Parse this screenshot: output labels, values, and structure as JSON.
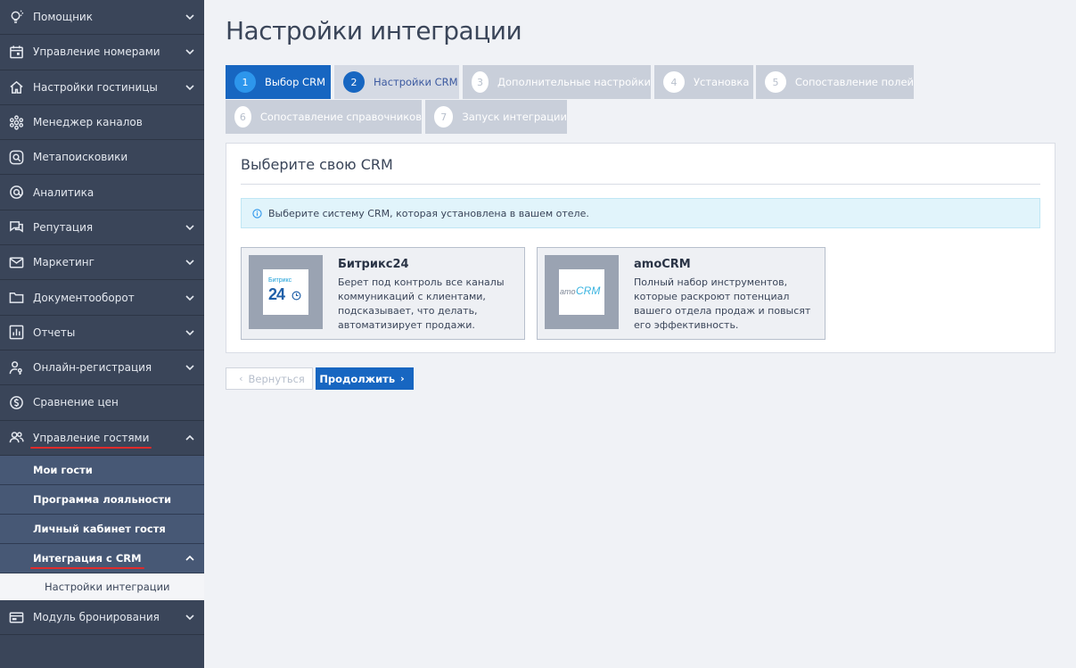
{
  "sidebar": {
    "items": [
      {
        "label": "Помощник",
        "icon": "lightbulb-icon",
        "chevron": "down"
      },
      {
        "label": "Управление номерами",
        "icon": "calendar-icon",
        "chevron": "down"
      },
      {
        "label": "Настройки гостиницы",
        "icon": "home-icon",
        "chevron": "down"
      },
      {
        "label": "Менеджер каналов",
        "icon": "network-icon",
        "chevron": "none"
      },
      {
        "label": "Метапоисковики",
        "icon": "search-icon",
        "chevron": "none"
      },
      {
        "label": "Аналитика",
        "icon": "at-icon",
        "chevron": "none"
      },
      {
        "label": "Репутация",
        "icon": "chat-icon",
        "chevron": "down"
      },
      {
        "label": "Маркетинг",
        "icon": "mail-icon",
        "chevron": "down"
      },
      {
        "label": "Документооборот",
        "icon": "folder-icon",
        "chevron": "down"
      },
      {
        "label": "Отчеты",
        "icon": "chart-icon",
        "chevron": "down"
      },
      {
        "label": "Онлайн-регистрация",
        "icon": "user-key-icon",
        "chevron": "down"
      },
      {
        "label": "Сравнение цен",
        "icon": "dollar-icon",
        "chevron": "none"
      },
      {
        "label": "Управление гостями",
        "icon": "users-icon",
        "chevron": "up"
      }
    ],
    "guests_sub": [
      {
        "label": "Мои гости"
      },
      {
        "label": "Программа лояльности"
      },
      {
        "label": "Личный кабинет гостя"
      },
      {
        "label": "Интеграция с CRM"
      }
    ],
    "crm_sub": [
      {
        "label": "Настройки интеграции"
      }
    ],
    "last_item": {
      "label": "Модуль бронирования",
      "icon": "booking-icon"
    }
  },
  "main": {
    "title": "Настройки интеграции",
    "steps": [
      {
        "num": "1",
        "label": "Выбор CRM"
      },
      {
        "num": "2",
        "label": "Настройки CRM"
      },
      {
        "num": "3",
        "label": "Дополнительные настройки"
      },
      {
        "num": "4",
        "label": "Установка"
      },
      {
        "num": "5",
        "label": "Сопоставление полей"
      },
      {
        "num": "6",
        "label": "Сопоставление справочников"
      },
      {
        "num": "7",
        "label": "Запуск интеграции"
      }
    ],
    "card_title": "Выберите свою CRM",
    "alert_text": "Выберите систему CRM, которая установлена в вашем отеле.",
    "crms": [
      {
        "name": "Битрикс24",
        "description": "Берет под контроль все каналы коммуникаций с клиентами, подсказывает, что делать, автоматизирует продажи.",
        "logo_text": "Битрикс",
        "logo_number": "24"
      },
      {
        "name": "amoCRM",
        "description": "Полный набор инструментов, которые раскроют потенциал вашего отдела продаж и повысят его эффективность.",
        "logo_text": "amo",
        "logo_brand": "CRM"
      }
    ],
    "back_label": "Вернуться",
    "next_label": "Продолжить"
  },
  "colors": {
    "sidebar_bg": "#3a4559",
    "sub_bg": "#475875",
    "accent": "#1766c1",
    "step_active_circle": "#2d96ec",
    "step_inactive": "#c9cfda",
    "underline": "#e02b2b"
  }
}
